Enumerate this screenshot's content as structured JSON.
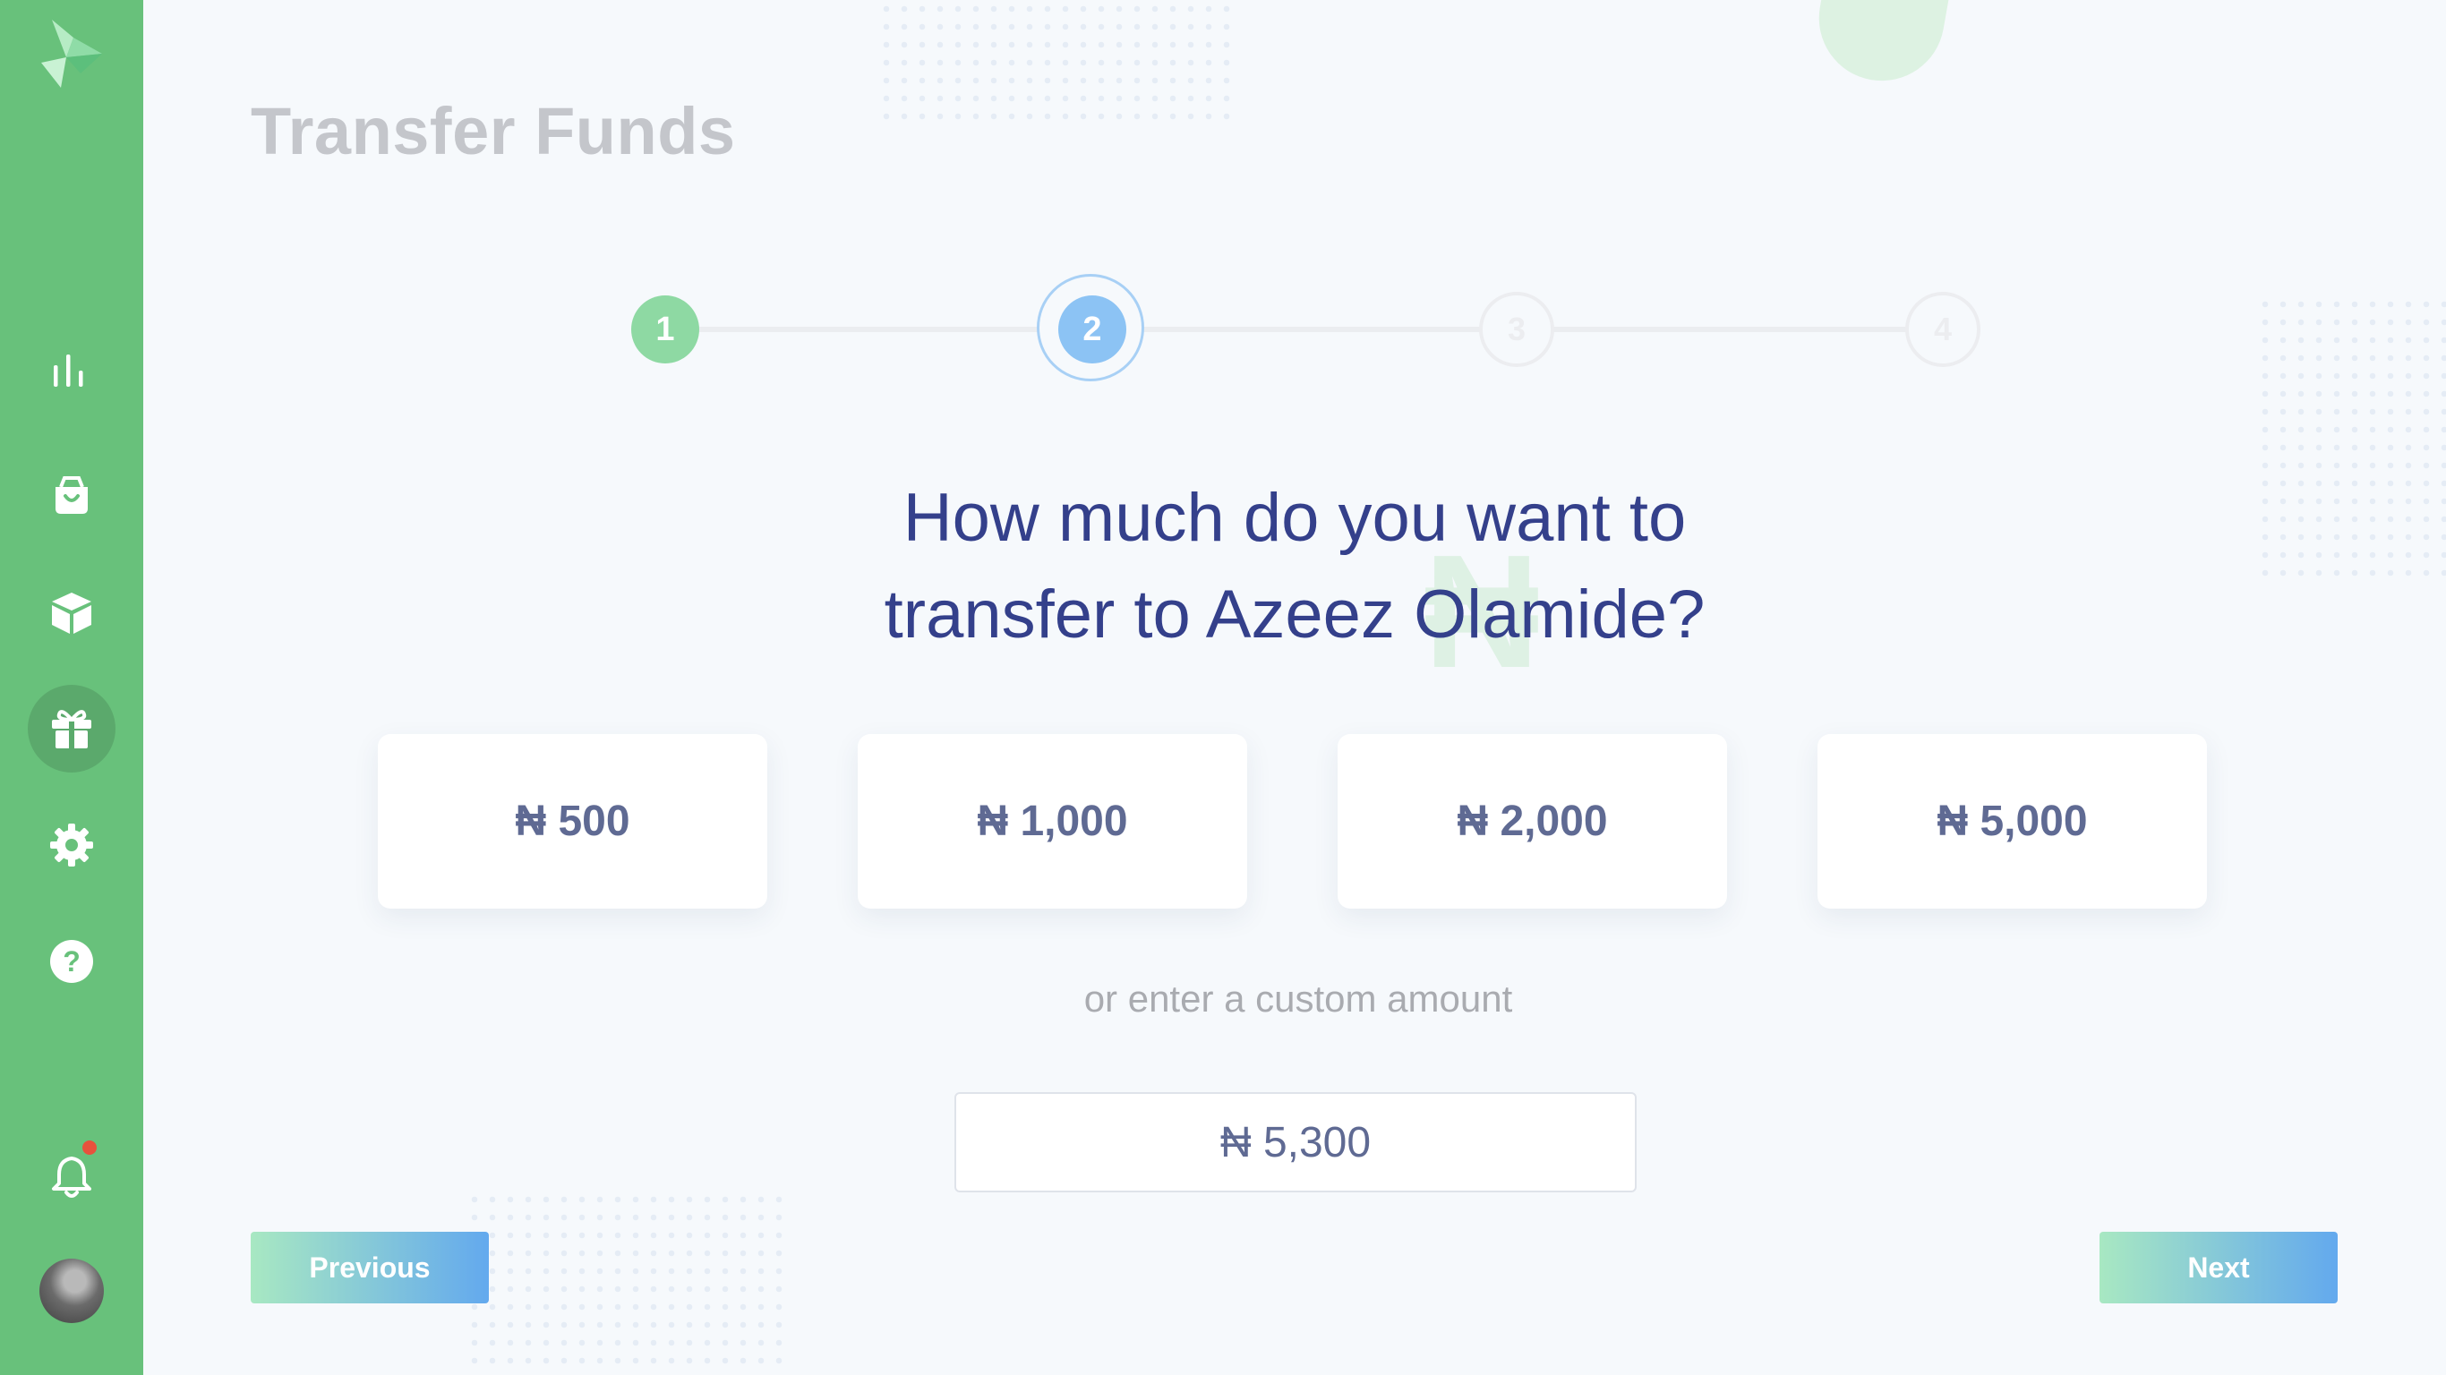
{
  "page": {
    "title": "Transfer Funds"
  },
  "sidebar": {
    "items": [
      {
        "icon": "bar-chart-icon"
      },
      {
        "icon": "shopping-bag-icon"
      },
      {
        "icon": "box-icon"
      },
      {
        "icon": "gift-icon",
        "active": true
      },
      {
        "icon": "settings-gear-icon"
      },
      {
        "icon": "help-icon"
      }
    ],
    "notifications": {
      "icon": "bell-icon",
      "has_unread": true
    }
  },
  "stepper": {
    "steps": [
      "1",
      "2",
      "3",
      "4"
    ],
    "current": 2
  },
  "question": {
    "line1": "How much do you want to",
    "line2": "transfer to Azeez Olamide?"
  },
  "amounts": [
    "₦ 500",
    "₦ 1,000",
    "₦ 2,000",
    "₦ 5,000"
  ],
  "custom": {
    "prompt": "or enter a custom amount",
    "value": "₦ 5,300"
  },
  "buttons": {
    "previous": "Previous",
    "next": "Next"
  },
  "colors": {
    "sidebar": "#68c17b",
    "heading": "#34408b",
    "step_done": "#8ed9a3",
    "step_active": "#8cc3f4",
    "notification_dot": "#e8513c"
  }
}
